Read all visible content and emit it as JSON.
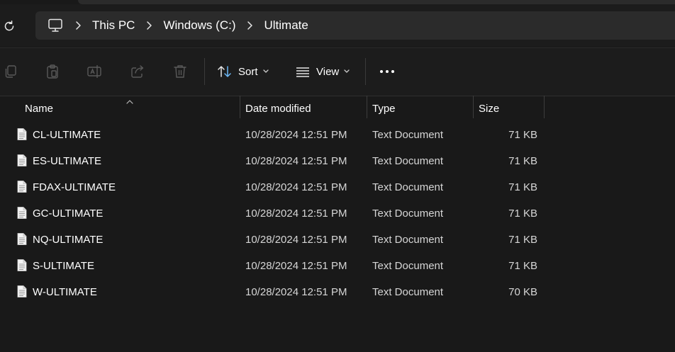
{
  "window": {
    "breadcrumbs": [
      "This PC",
      "Windows (C:)",
      "Ultimate"
    ],
    "icons": {
      "refresh": "refresh-icon",
      "pc": "computer-icon",
      "separator": "chevron-right-icon"
    }
  },
  "toolbar": {
    "copy_icon": "copy-icon",
    "paste_icon": "paste-icon",
    "rename_icon": "rename-icon",
    "share_icon": "share-icon",
    "delete_icon": "delete-icon",
    "sort_label": "Sort",
    "view_label": "View",
    "more_icon": "more-icon"
  },
  "columns": {
    "name": "Name",
    "date": "Date modified",
    "type": "Type",
    "size": "Size"
  },
  "files": [
    {
      "name": "CL-ULTIMATE",
      "date": "10/28/2024 12:51 PM",
      "type": "Text Document",
      "size": "71 KB"
    },
    {
      "name": "ES-ULTIMATE",
      "date": "10/28/2024 12:51 PM",
      "type": "Text Document",
      "size": "71 KB"
    },
    {
      "name": "FDAX-ULTIMATE",
      "date": "10/28/2024 12:51 PM",
      "type": "Text Document",
      "size": "71 KB"
    },
    {
      "name": "GC-ULTIMATE",
      "date": "10/28/2024 12:51 PM",
      "type": "Text Document",
      "size": "71 KB"
    },
    {
      "name": "NQ-ULTIMATE",
      "date": "10/28/2024 12:51 PM",
      "type": "Text Document",
      "size": "71 KB"
    },
    {
      "name": "S-ULTIMATE",
      "date": "10/28/2024 12:51 PM",
      "type": "Text Document",
      "size": "71 KB"
    },
    {
      "name": "W-ULTIMATE",
      "date": "10/28/2024 12:51 PM",
      "type": "Text Document",
      "size": "70 KB"
    }
  ],
  "colors": {
    "background": "#191919",
    "address_bar": "#2b2b2b",
    "disabled_icon": "#5a5a5a",
    "text": "#ffffff"
  }
}
